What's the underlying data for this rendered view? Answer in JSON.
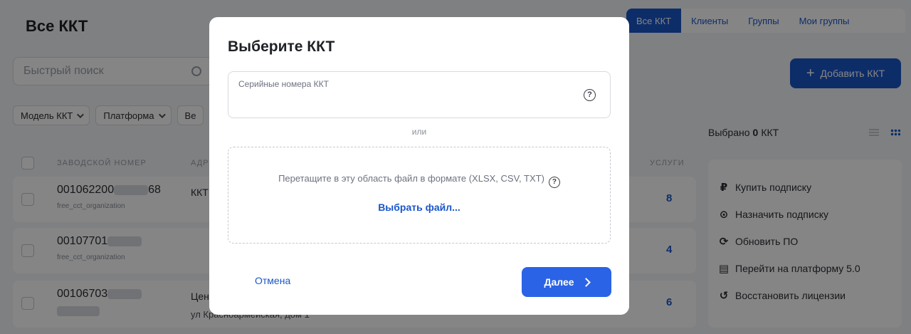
{
  "page": {
    "title": "Все ККТ",
    "tabs": [
      {
        "label": "Все ККТ",
        "active": true
      },
      {
        "label": "Клиенты",
        "active": false
      },
      {
        "label": "Группы",
        "active": false
      },
      {
        "label": "Мои группы",
        "active": false
      }
    ],
    "search_placeholder": "Быстрый поиск",
    "add_button": "Добавить ККТ",
    "filters": [
      "Модель ККТ",
      "Платформа",
      "Ве"
    ],
    "selected": {
      "prefix": "Выбрано",
      "count": "0",
      "suffix": "ККТ"
    },
    "table": {
      "headers": {
        "serial": "ЗАВОДСКОЙ НОМЕР",
        "address": "АДР",
        "services": "УСЛУГИ"
      },
      "rows": [
        {
          "serial": "001062200",
          "serial_tail": "68",
          "org": "free_cct_organization",
          "address": "ККТ",
          "address2": "",
          "count": "8"
        },
        {
          "serial": "00107701",
          "serial_tail": "",
          "org": "free_cct_organization",
          "address": "",
          "address2": "",
          "count": "4"
        },
        {
          "serial": "00106703",
          "serial_tail": "",
          "org": "",
          "address": "Цен",
          "address2": "ул Красноармейская, дом 1",
          "count": "6"
        }
      ]
    },
    "actions": [
      {
        "icon": "ruble-icon",
        "glyph": "₽",
        "label": "Купить подписку"
      },
      {
        "icon": "play-circle-icon",
        "glyph": "⊙",
        "label": "Назначить подписку"
      },
      {
        "icon": "refresh-icon",
        "glyph": "⟳",
        "label": "Обновить ПО"
      },
      {
        "icon": "device-icon",
        "glyph": "▤",
        "label": "Перейти на платформу 5.0"
      },
      {
        "icon": "restore-icon",
        "glyph": "↺",
        "label": "Восстановить лицензии"
      }
    ]
  },
  "modal": {
    "title": "Выберите ККТ",
    "serial_field_label": "Серийные номера ККТ",
    "help_glyph": "?",
    "or_text": "или",
    "drop_text": "Перетащите в эту область файл в формате (XLSX, CSV, TXT)",
    "choose_file": "Выбрать файл...",
    "cancel": "Отмена",
    "next": "Далее"
  },
  "colors": {
    "accent": "#1a56c9",
    "primary_button": "#2a63e6",
    "overlay": "rgba(0,0,0,0.48)"
  }
}
